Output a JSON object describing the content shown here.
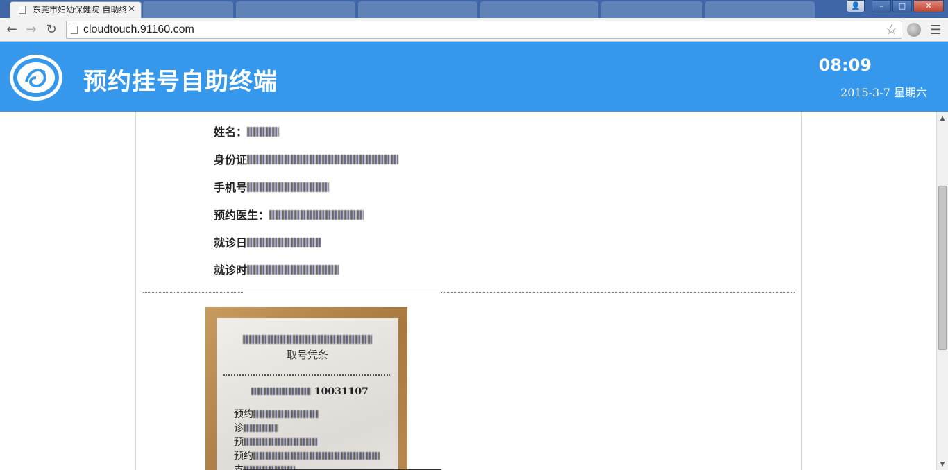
{
  "browser": {
    "active_tab_title": "东莞市妇幼保健院-自助终",
    "url": "cloudtouch.91160.com",
    "window_buttons": {
      "user": "👤",
      "minimize": "–",
      "maximize": "□",
      "close": "✕"
    },
    "icons": {
      "back": "back-arrow-icon",
      "forward": "forward-arrow-icon",
      "reload": "reload-icon",
      "star": "bookmark-star-icon",
      "menu": "hamburger-menu-icon"
    }
  },
  "header": {
    "title": "预约挂号自助终端",
    "time": "08:09",
    "date": "2015-3-7 星期六",
    "bg_color": "#3598ec"
  },
  "info": {
    "name_label": "姓名：",
    "id_label": "身份证",
    "phone_label": "手机号",
    "doctor_label": "预约医生：",
    "date_label": "就诊日",
    "time_label": "就诊时"
  },
  "receipt": {
    "title_line2": "取号凭条",
    "order_value": "10031107",
    "line_labels": [
      "预约",
      "诊",
      "预",
      "预约",
      "支"
    ]
  }
}
